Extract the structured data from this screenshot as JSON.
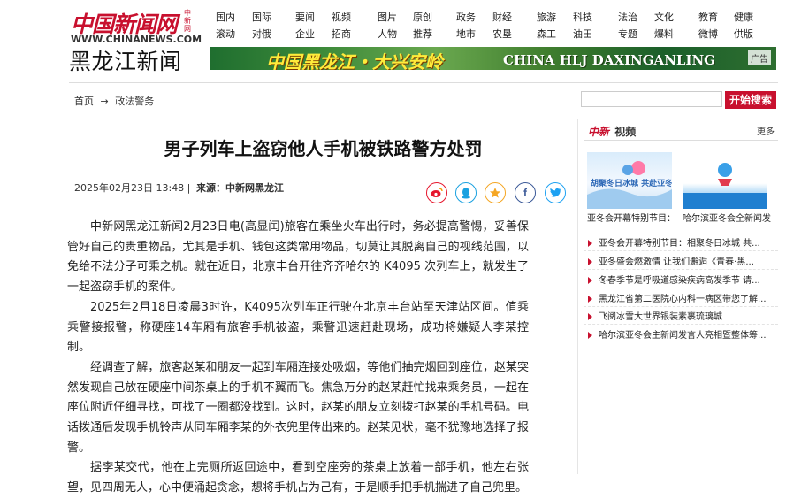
{
  "header": {
    "logo_text": "中国新闻网",
    "logo_side": "中新网",
    "logo_url": "WWW.CHINANEWS.COM",
    "site_title": "黑龙江新闻",
    "nav_top": [
      "国内",
      "国际",
      "要闻",
      "视频",
      "图片",
      "原创",
      "政务",
      "财经",
      "旅游",
      "科技",
      "法治",
      "文化",
      "教育",
      "健康"
    ],
    "nav_bottom": [
      "滚动",
      "对俄",
      "企业",
      "招商",
      "人物",
      "推荐",
      "地市",
      "农垦",
      "森工",
      "油田",
      "专题",
      "爆料",
      "微博",
      "供版"
    ]
  },
  "banner": {
    "cn_text": "中国黑龙江・大兴安岭",
    "en_text": "CHINA HLJ DAXINGANLING",
    "ad_label": "广告"
  },
  "breadcrumb": {
    "home": "首页",
    "arrow": "→",
    "section": "政法警务"
  },
  "search": {
    "placeholder": "",
    "button": "开始搜索"
  },
  "article": {
    "title": "男子列车上盗窃他人手机被铁路警方处罚",
    "date": "2025年02月23日 13:48 |",
    "source": "来源：中新网黑龙江",
    "paragraphs": [
      "中新网黑龙江新闻2月23日电(高显闰)旅客在乘坐火车出行时，务必提高警惕，妥善保管好自己的贵重物品，尤其是手机、钱包这类常用物品，切莫让其脱离自己的视线范围，以免给不法分子可乘之机。就在近日，北京丰台开往齐齐哈尔的 K4095 次列车上，就发生了一起盗窃手机的案件。",
      "2025年2月18日凌晨3时许，K4095次列车正行驶在北京丰台站至天津站区间。值乘乘警接报警，称硬座14车厢有旅客手机被盗，乘警迅速赶赴现场，成功将嫌疑人李某控制。",
      "经调查了解，旅客赵某和朋友一起到车厢连接处吸烟，等他们抽完烟回到座位，赵某突然发现自己放在硬座中间茶桌上的手机不翼而飞。焦急万分的赵某赶忙找来乘务员，一起在座位附近仔细寻找，可找了一圈都没找到。这时，赵某的朋友立刻拨打赵某的手机号码。电话拨通后发现手机铃声从同车厢李某的外衣兜里传出来的。赵某见状，毫不犹豫地选择了报警。",
      "据李某交代，他在上完厕所返回途中，看到空座旁的茶桌上放着一部手机，他左右张望，见四周无人，心中便涌起贪念，想将手机占为己有，于是顺手把手机揣进了自己兜里。"
    ]
  },
  "sidebar": {
    "video_logo": "中新",
    "video_label": "视频",
    "more": "更多",
    "thumbs": [
      {
        "caption": "亚冬会开幕特别节目：",
        "image_text": "胡聚冬日冰城 共赴亚冬之约"
      },
      {
        "caption": "哈尔滨亚冬会全新闻发",
        "image_text": ""
      }
    ],
    "news": [
      "亚冬会开幕特别节目：相聚冬日冰城 共...",
      "亚冬盛会燃激情 让我们邂逅《青春·黑...",
      "冬春季节是呼吸道感染疾病高发季节 请...",
      "黑龙江省第二医院心内科一病区带您了解...",
      "飞阅冰雪大世界银装素裹琉璃城",
      "哈尔滨亚冬会主新闻发言人亮相暨整体筹..."
    ]
  },
  "colors": {
    "brand": "#c8102e"
  }
}
